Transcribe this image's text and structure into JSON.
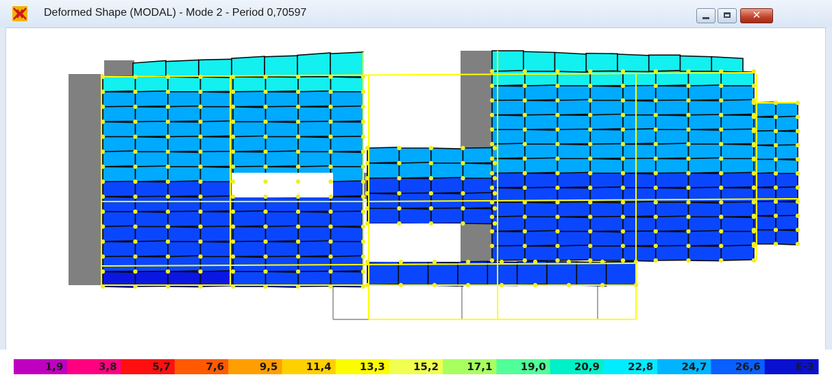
{
  "window": {
    "title": "Deformed Shape (MODAL) - Mode 2 - Period 0,70597",
    "app_icon": "sap2000-logo-icon",
    "controls": {
      "minimize_icon": "minimize-icon",
      "maximize_icon": "maximize-icon",
      "close_icon": "close-icon",
      "close_glyph": "✕"
    }
  },
  "colors": {
    "contour_cyan": "#12f0f0",
    "contour_light_blue": "#00aaff",
    "contour_blue": "#0b46ff",
    "contour_dark_blue": "#0a17e2",
    "grid_line": "#0a0a0a",
    "frame_yellow": "#ffff00",
    "joint_yellow": "#f2ee26",
    "undeformed_gray": "#808080"
  },
  "legend": {
    "labels": [
      "1,9",
      "3,8",
      "5,7",
      "7,6",
      "9,5",
      "11,4",
      "13,3",
      "15,2",
      "17,1",
      "19,0",
      "20,9",
      "22,8",
      "24,7",
      "26,6",
      "E-3"
    ],
    "colors": [
      "#c000c0",
      "#ff0080",
      "#ff1010",
      "#ff5a00",
      "#ff9e00",
      "#ffd000",
      "#fcfc00",
      "#f0ff50",
      "#a8ff60",
      "#50ff98",
      "#00f0c8",
      "#00ecff",
      "#00b4ff",
      "#0860ff",
      "#0a10d0"
    ]
  }
}
